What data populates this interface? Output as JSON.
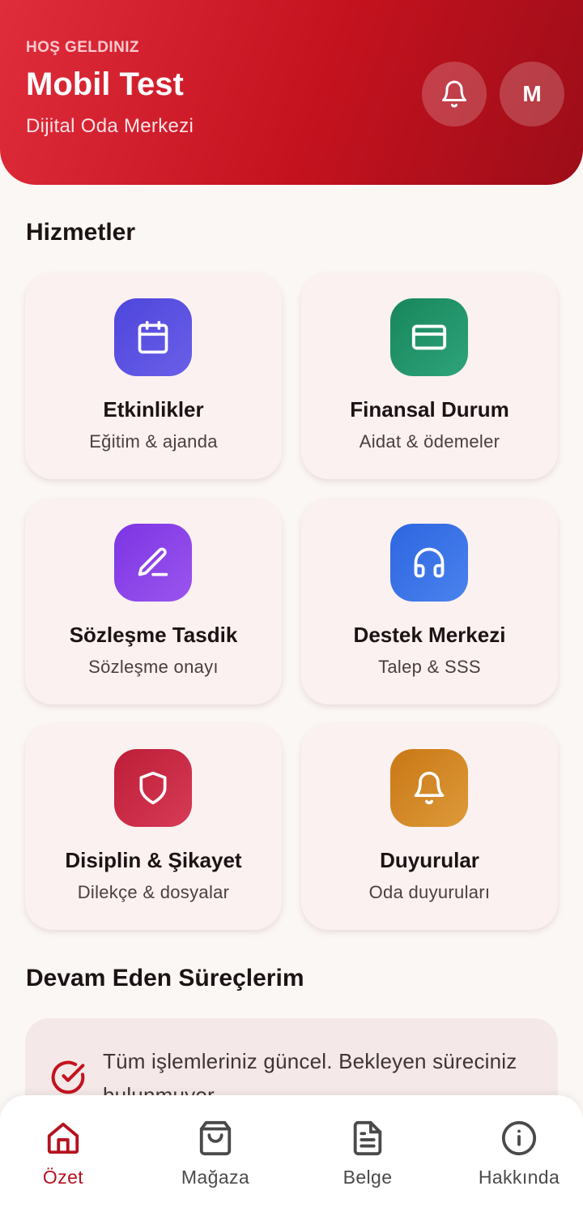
{
  "header": {
    "welcome": "HOŞ GELDINIZ",
    "user_name": "Mobil Test",
    "org_name": "Dijital Oda Merkezi",
    "avatar_initial": "M",
    "notification_icon": "bell-icon"
  },
  "services": {
    "title": "Hizmetler",
    "items": [
      {
        "title": "Etkinlikler",
        "subtitle": "Eğitim & ajanda",
        "icon": "calendar-icon",
        "color": "#5b4fe0"
      },
      {
        "title": "Finansal Durum",
        "subtitle": "Aidat & ödemeler",
        "icon": "credit-card-icon",
        "color": "#22956a"
      },
      {
        "title": "Sözleşme Tasdik",
        "subtitle": "Sözleşme onayı",
        "icon": "pen-icon",
        "color": "#8a42e8"
      },
      {
        "title": "Destek Merkezi",
        "subtitle": "Talep & SSS",
        "icon": "headphones-icon",
        "color": "#3a73e6"
      },
      {
        "title": "Disiplin & Şikayet",
        "subtitle": "Dilekçe & dosyalar",
        "icon": "shield-icon",
        "color": "#c7233f"
      },
      {
        "title": "Duyurular",
        "subtitle": "Oda duyuruları",
        "icon": "bell-icon",
        "color": "#d0831e"
      }
    ]
  },
  "processes": {
    "title": "Devam Eden Süreçlerim",
    "message": "Tüm işlemleriniz güncel. Bekleyen süreciniz bulunmuyor.",
    "icon": "check-circle-icon"
  },
  "bottom_nav": {
    "items": [
      {
        "label": "Özet",
        "icon": "home-icon",
        "active": true
      },
      {
        "label": "Mağaza",
        "icon": "shopping-bag-icon",
        "active": false
      },
      {
        "label": "Belge",
        "icon": "document-icon",
        "active": false
      },
      {
        "label": "Hakkında",
        "icon": "info-icon",
        "active": false
      }
    ]
  },
  "colors": {
    "brand": "#c4121f",
    "active_nav": "#b5121f",
    "background": "#fbf7f5"
  }
}
